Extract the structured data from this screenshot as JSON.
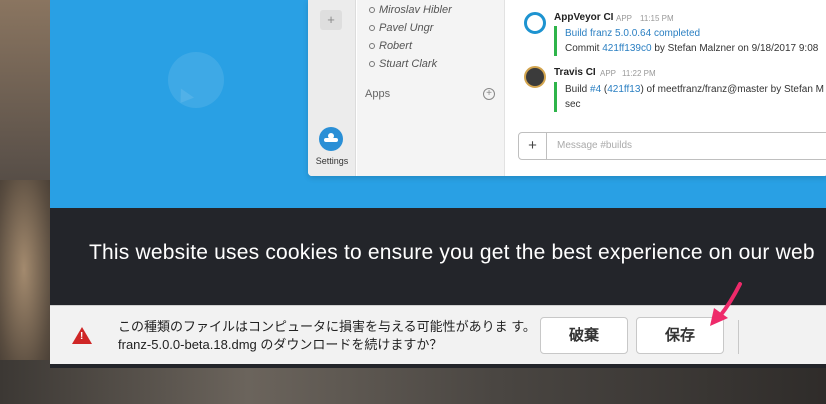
{
  "website": {
    "cookie_notice": "This website uses cookies to ensure you get the best experience on our web"
  },
  "app": {
    "sidebar": {
      "add_label": "+",
      "settings_label": "Settings"
    },
    "members": [
      "Miroslav Hibler",
      "Pavel Ungr",
      "Robert",
      "Stuart Clark"
    ],
    "apps_label": "Apps",
    "apps_add": "+",
    "messages": [
      {
        "name": "AppVeyor CI",
        "badge": "APP",
        "time": "11:15 PM",
        "line1": "Build franz 5.0.0.64 completed",
        "line2_prefix": "Commit ",
        "line2_link": "421ff139c0",
        "line2_suffix": " by Stefan Malzner on 9/18/2017 9:08"
      },
      {
        "name": "Travis CI",
        "badge": "APP",
        "time": "11:22 PM",
        "line1_prefix": "Build ",
        "line1_link1": "#4",
        "line1_mid": " (",
        "line1_link2": "421ff13",
        "line1_suffix": ") of meetfranz/franz@master by Stefan M",
        "line2": "sec"
      }
    ],
    "composer": {
      "plus": "+",
      "placeholder": "Message #builds"
    }
  },
  "download_bar": {
    "warning_icon": "!",
    "message": "この種類のファイルはコンピュータに損害を与える可能性がありま す。franz-5.0.0-beta.18.dmg のダウンロードを続けますか？",
    "discard_label": "破棄",
    "keep_label": "保存"
  },
  "colors": {
    "hero_blue": "#29a0e4",
    "annotation_arrow": "#ee2a6a",
    "warning_red": "#cf2626"
  }
}
